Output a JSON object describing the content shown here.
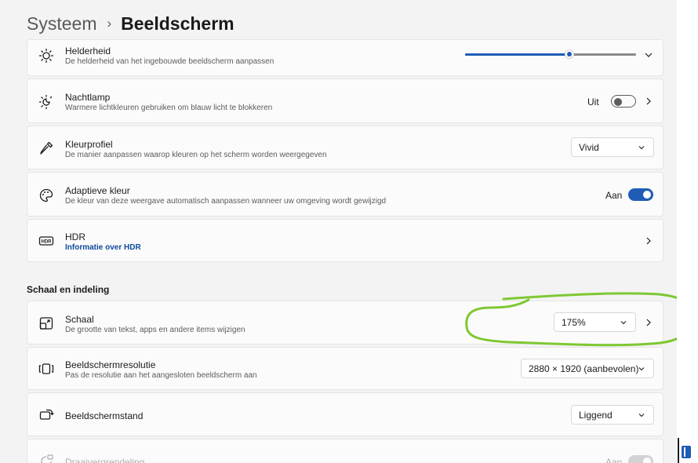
{
  "breadcrumb": {
    "parent": "Systeem",
    "separator": "›",
    "current": "Beeldscherm"
  },
  "brightness": {
    "title": "Helderheid",
    "subtitle": "De helderheid van het ingebouwde beeldscherm aanpassen",
    "value_fraction": 0.61,
    "icon": "sun-icon"
  },
  "night_light": {
    "title": "Nachtlamp",
    "subtitle": "Warmere lichtkleuren gebruiken om blauw licht te blokkeren",
    "toggle_label": "Uit",
    "toggle_on": false,
    "icon": "night-light-icon"
  },
  "color_profile": {
    "title": "Kleurprofiel",
    "subtitle": "De manier aanpassen waarop kleuren op het scherm worden weergegeven",
    "selected": "Vivid",
    "icon": "eyedropper-icon"
  },
  "adaptive_color": {
    "title": "Adaptieve kleur",
    "subtitle": "De kleur van deze weergave automatisch aanpassen wanneer uw omgeving wordt gewijzigd",
    "toggle_label": "Aan",
    "toggle_on": true,
    "icon": "palette-icon"
  },
  "hdr": {
    "title": "HDR",
    "link": "Informatie over HDR",
    "icon": "hdr-icon"
  },
  "section": {
    "title": "Schaal en indeling"
  },
  "scale": {
    "title": "Schaal",
    "subtitle": "De grootte van tekst, apps en andere items wijzigen",
    "selected": "175%",
    "icon": "scale-icon"
  },
  "resolution": {
    "title": "Beeldschermresolutie",
    "subtitle": "Pas de resolutie aan het aangesloten beeldscherm aan",
    "selected": "2880 × 1920 (aanbevolen)",
    "icon": "resolution-icon"
  },
  "orientation": {
    "title": "Beeldschermstand",
    "selected": "Liggend",
    "icon": "orientation-icon"
  },
  "rotation_lock": {
    "title": "Draaivergrendeling",
    "toggle_label": "Aan",
    "icon": "rotation-lock-icon"
  },
  "colors": {
    "accent": "#1f5cb5",
    "annotation": "#7ec832",
    "link": "#0e4a9c",
    "background": "#f3f3f3",
    "card": "#fbfbfb"
  }
}
